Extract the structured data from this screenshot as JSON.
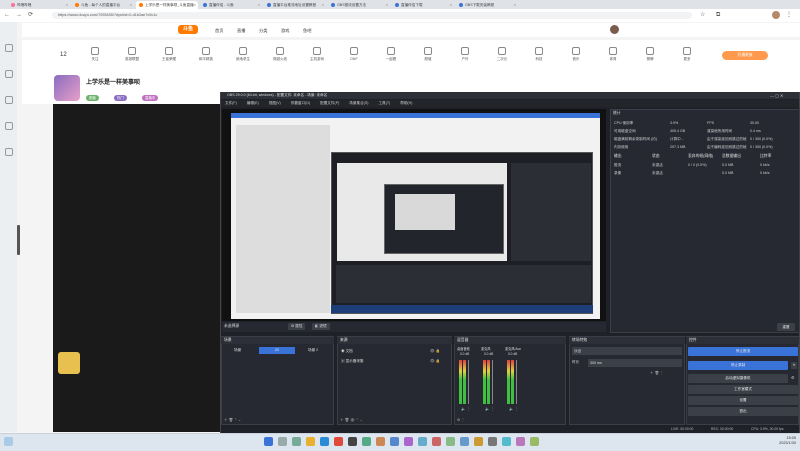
{
  "browser": {
    "tabs": [
      {
        "label": "哔哩哔哩",
        "color": "#fb7299"
      },
      {
        "label": "斗鱼 - 每个人的直播平台",
        "color": "#ff7a00"
      },
      {
        "label": "上学乐是一样美事呗_斗鱼直播",
        "color": "#ff7a00",
        "active": true
      },
      {
        "label": "直播伴侣 - 斗鱼",
        "color": "#3a73d8"
      },
      {
        "label": "直播平台推流地址设置教程",
        "color": "#3a73d8"
      },
      {
        "label": "OBS推流设置方法",
        "color": "#3a73d8"
      },
      {
        "label": "直播伴侣下载",
        "color": "#3a73d8"
      },
      {
        "label": "OBS下载安装教程",
        "color": "#3a73d8"
      }
    ],
    "url": "https://www.douyu.com/7093455/?dyshid=0-d1b2ae7c9c1c"
  },
  "douyu": {
    "logo": "斗鱼",
    "nav": [
      "首页",
      "直播",
      "分类",
      "游戏",
      "鱼吧"
    ],
    "follow_count": "12",
    "categories": [
      "关注",
      "英雄联盟",
      "王者荣耀",
      "和平精英",
      "绝地求生",
      "穿越火线",
      "主机游戏",
      "DNF",
      "一起看",
      "颜值",
      "户外",
      "二次元",
      "科技",
      "音乐",
      "体育",
      "棋牌",
      "更多"
    ],
    "streamer_name": "上学乐是一样美事呗",
    "streamer_tags": [
      "颜值",
      "热门",
      "直播中"
    ],
    "promo_btn": "开通贵族"
  },
  "obs": {
    "title": "OBS 29.0.0 (64-bit, windows) - 配置文件: 未命名 - 场景: 未命名",
    "menu": [
      "文件(F)",
      "编辑(E)",
      "视图(V)",
      "停靠窗口(D)",
      "配置文件(P)",
      "场景集合(S)",
      "工具(T)",
      "帮助(H)"
    ],
    "source_label": "未选择源",
    "props_btn": "属性",
    "filters_btn": "滤镜",
    "stats": {
      "header": "统计",
      "rows": [
        {
          "k1": "CPU 使用率",
          "v1": "3.9%",
          "k2": "FPS",
          "v2": "30.00"
        },
        {
          "k1": "可用磁盘空间",
          "v1": "405.4 GB",
          "k2": "渲染帧所用时间",
          "v2": "0.4 ms"
        },
        {
          "k1": "磁盘满前剩余录制时间 (约)",
          "v1": "计算中...",
          "k2": "由于渲染延迟而跳过的帧",
          "v2": "0 / 350 (0.0%)"
        },
        {
          "k1": "内存使用",
          "v1": "297.3 MB",
          "k2": "由于编码延迟而跳过的帧",
          "v2": "0 / 350 (0.0%)"
        }
      ],
      "output_cols": [
        "输出",
        "状态",
        "丢弃的帧(网络)",
        "总数据输出",
        "比特率"
      ],
      "outputs": [
        {
          "name": "推流",
          "status": "未激活",
          "dropped": "0 / 0 (0.0%)",
          "total": "0.0 MB",
          "bitrate": "0 kb/s"
        },
        {
          "name": "录像",
          "status": "未激活",
          "dropped": "",
          "total": "0.0 MB",
          "bitrate": "0 kb/s"
        }
      ],
      "reset": "重置"
    },
    "docks": {
      "scenes": {
        "title": "场景",
        "items": [
          "场景",
          "2D",
          "场景 2"
        ]
      },
      "sources": {
        "title": "来源",
        "items": [
          "文档",
          "显示器采集"
        ]
      },
      "mixer": {
        "title": "混音器",
        "channels": [
          {
            "name": "桌面音频",
            "db": "0.0 dB"
          },
          {
            "name": "麦克风",
            "db": "0.0 dB"
          },
          {
            "name": "麦克风/Aux",
            "db": "0.0 dB"
          }
        ]
      },
      "transitions": {
        "title": "转场特效",
        "type": "淡出",
        "duration_label": "时长",
        "duration": "300 ms"
      },
      "controls": {
        "title": "控件",
        "buttons": [
          "停止推流",
          "停止录制",
          "启动虚拟摄像机",
          "工作室模式",
          "设置",
          "退出"
        ]
      }
    },
    "status": {
      "live": "LIVE: 00:00:00",
      "rec": "REC: 00:00:00",
      "cpu": "CPU: 3.9%, 30.00 fps"
    }
  },
  "taskbar": {
    "time": "15:05",
    "date": "2023/1/30"
  },
  "colors": {
    "accent_blue": "#3a73d8",
    "douyu_orange": "#ff7a00",
    "obs_bg": "#1f2128"
  }
}
